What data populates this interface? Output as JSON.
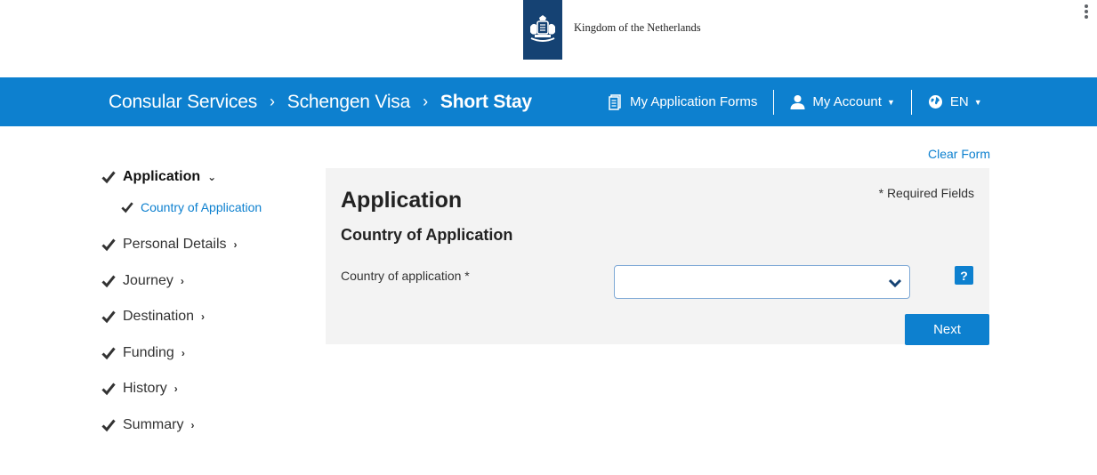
{
  "header": {
    "gov_title": "Kingdom of the Netherlands"
  },
  "navbar": {
    "breadcrumbs": [
      "Consular Services",
      "Schengen Visa",
      "Short Stay"
    ],
    "links": {
      "forms": "My Application Forms",
      "account": "My Account",
      "language": "EN"
    }
  },
  "clear_form": "Clear Form",
  "sidebar": {
    "steps": [
      {
        "label": "Application",
        "active": true,
        "expanded": true
      },
      {
        "label": "Personal Details"
      },
      {
        "label": "Journey"
      },
      {
        "label": "Destination"
      },
      {
        "label": "Funding"
      },
      {
        "label": "History"
      },
      {
        "label": "Summary"
      }
    ],
    "substep": "Country of Application"
  },
  "form": {
    "title": "Application",
    "required_note": "* Required Fields",
    "section_title": "Country of Application",
    "field_label": "Country of application *",
    "field_value": "",
    "help": "?",
    "next": "Next"
  },
  "colors": {
    "primary": "#0d80cf",
    "logo_bg": "#154273",
    "panel_bg": "#f3f3f3"
  },
  "icons": [
    "coat-of-arms-logo",
    "document-icon",
    "user-icon",
    "globe-icon",
    "check-icon",
    "chevron-right-icon",
    "chevron-down-icon",
    "help-icon",
    "kebab-menu-icon"
  ]
}
